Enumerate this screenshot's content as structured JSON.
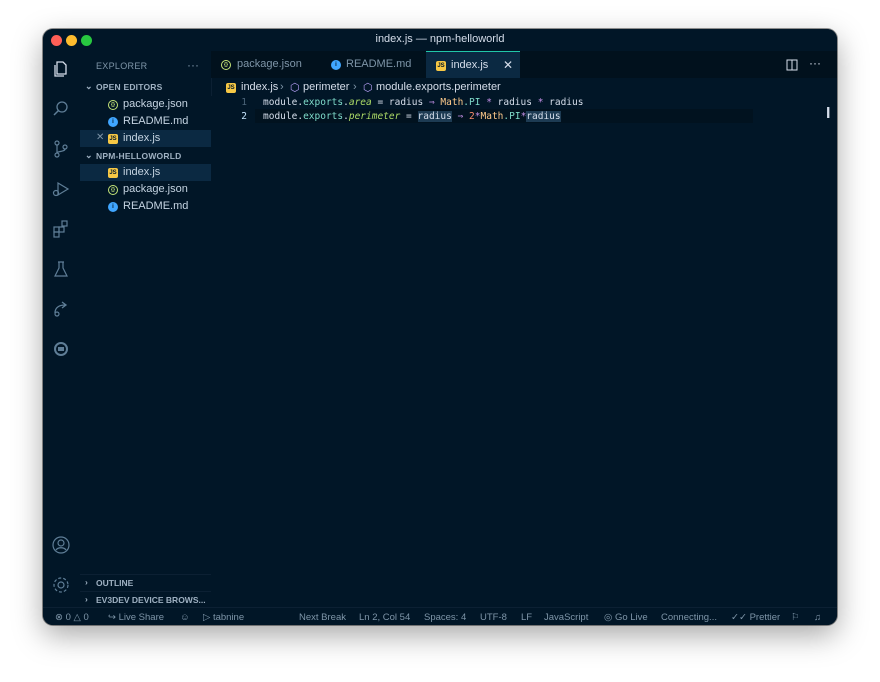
{
  "window": {
    "title": "index.js — npm-helloworld"
  },
  "activity_bar": {
    "icons": [
      "files-icon",
      "search-icon",
      "source-control-icon",
      "run-debug-icon",
      "extensions-icon",
      "testing-icon",
      "live-share-icon",
      "device-icon",
      "account-icon",
      "settings-gear-icon"
    ]
  },
  "sidebar": {
    "title": "EXPLORER",
    "more": "···",
    "open_editors": {
      "label": "OPEN EDITORS",
      "items": [
        {
          "name": "package.json"
        },
        {
          "name": "README.md"
        },
        {
          "name": "index.js"
        }
      ]
    },
    "project": {
      "label": "NPM-HELLOWORLD",
      "items": [
        {
          "name": "index.js"
        },
        {
          "name": "package.json"
        },
        {
          "name": "README.md"
        }
      ]
    },
    "outline": {
      "label": "OUTLINE"
    },
    "ev3dev": {
      "label": "EV3DEV DEVICE BROWS..."
    }
  },
  "tabs": [
    {
      "label": "package.json"
    },
    {
      "label": "README.md"
    },
    {
      "label": "index.js"
    }
  ],
  "breadcrumb": {
    "file": "index.js",
    "symbol1": "perimeter",
    "symbol2": "module.exports.perimeter"
  },
  "editor": {
    "line_numbers": [
      "1",
      "2"
    ],
    "lines": [
      {
        "t1": "module",
        "t2": ".",
        "t3": "exports",
        "t4": ".",
        "t5": "area",
        "t6": " = radius ",
        "t7": "⇒",
        "t8": " ",
        "t9": "Math",
        "t10": ".PI ",
        "t11": "*",
        "t12": " radius ",
        "t13": "*",
        "t14": " radius"
      },
      {
        "t1": "module",
        "t2": ".",
        "t3": "exports",
        "t4": ".",
        "t5": "perimeter",
        "t6": " = ",
        "t6b": "radius",
        "t6c": " ",
        "t7": "⇒",
        "t8": " ",
        "t8b": "2",
        "t8c": "*",
        "t9": "Math",
        "t10": ".PI",
        "t11": "*",
        "t12": "radius"
      }
    ]
  },
  "statusbar": {
    "errors": "0",
    "warnings": "0",
    "live_share": "Live Share",
    "tabnine": "tabnine",
    "next_break": "Next Break",
    "position": "Ln 2, Col 54",
    "spaces": "Spaces: 4",
    "encoding": "UTF-8",
    "eol": "LF",
    "language": "JavaScript",
    "go_live": "Go Live",
    "connecting": "Connecting...",
    "prettier": "Prettier"
  }
}
